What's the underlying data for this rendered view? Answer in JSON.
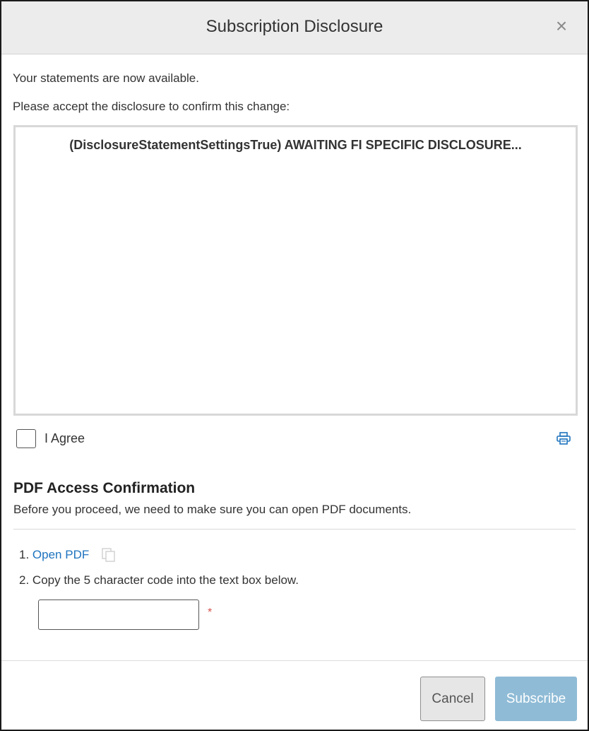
{
  "dialog": {
    "title": "Subscription Disclosure",
    "close_symbol": "×",
    "close_icon": "close-icon"
  },
  "intro": {
    "line1": "Your statements are now available.",
    "line2": "Please accept the disclosure to confirm this change:"
  },
  "disclosure": {
    "text": "(DisclosureStatementSettingsTrue) AWAITING FI SPECIFIC DISCLOSURE..."
  },
  "agree": {
    "label": "I Agree",
    "checked": false,
    "print_icon": "print-icon"
  },
  "pdf_section": {
    "heading": "PDF Access Confirmation",
    "description": "Before you proceed, we need to make sure you can open PDF documents.",
    "step1_number": "1.",
    "step1_link": "Open PDF",
    "copy_icon": "copy-icon",
    "step2_number": "2.",
    "step2_text": "Copy the 5 character code into the text box below.",
    "code_value": "",
    "required_marker": "*"
  },
  "footer": {
    "cancel_label": "Cancel",
    "subscribe_label": "Subscribe"
  },
  "colors": {
    "link": "#1e73be",
    "subscribe_disabled": "#8fbbd6",
    "header_bg": "#ececec",
    "required": "#d9534f"
  }
}
